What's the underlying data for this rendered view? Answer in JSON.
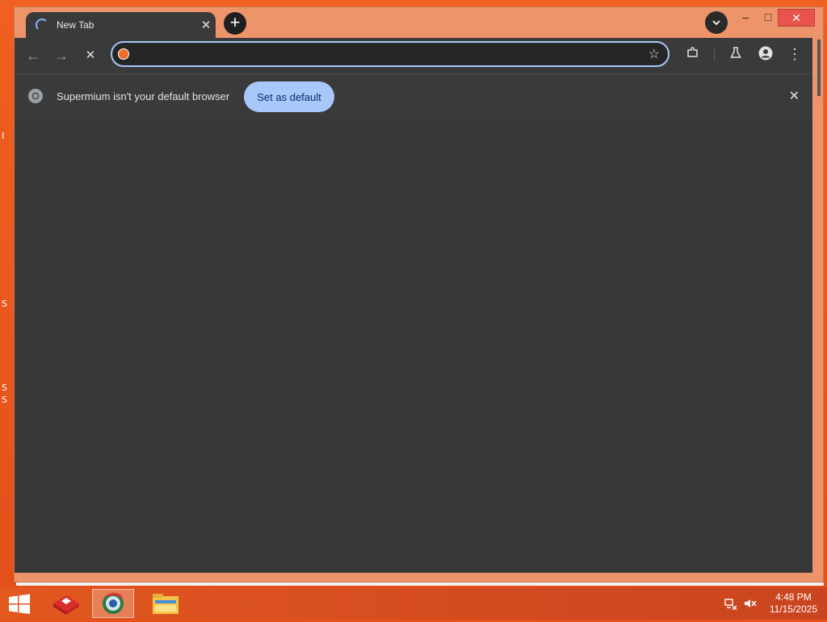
{
  "window": {
    "tab_title": "New Tab",
    "tab_close_glyph": "✕",
    "new_tab_glyph": "+",
    "tab_search_glyph": "⌄",
    "minimize_glyph": "–",
    "maximize_glyph": "□",
    "close_glyph": "✕"
  },
  "toolbar": {
    "back_glyph": "←",
    "forward_glyph": "→",
    "stop_glyph": "✕",
    "omnibox_value": "",
    "bookmark_glyph": "☆",
    "extensions_glyph": "⧉",
    "labs_glyph": "⚗",
    "menu_glyph": "⋮"
  },
  "infobar": {
    "message": "Supermium isn't your default browser",
    "button_label": "Set as default",
    "close_glyph": "✕"
  },
  "colors": {
    "accent": "#a8c7fa",
    "desktop": "#e8521b",
    "browser_frame": "#3a3a3a",
    "content": "#383838"
  },
  "taskbar": {
    "apps": [
      "start-icon",
      "app-red-icon",
      "supermium-icon",
      "file-explorer-icon"
    ],
    "time": "4:48 PM",
    "date": "11/15/2025"
  },
  "desktop_edge": {
    "labels": [
      "I",
      "S",
      "S",
      "S"
    ]
  }
}
